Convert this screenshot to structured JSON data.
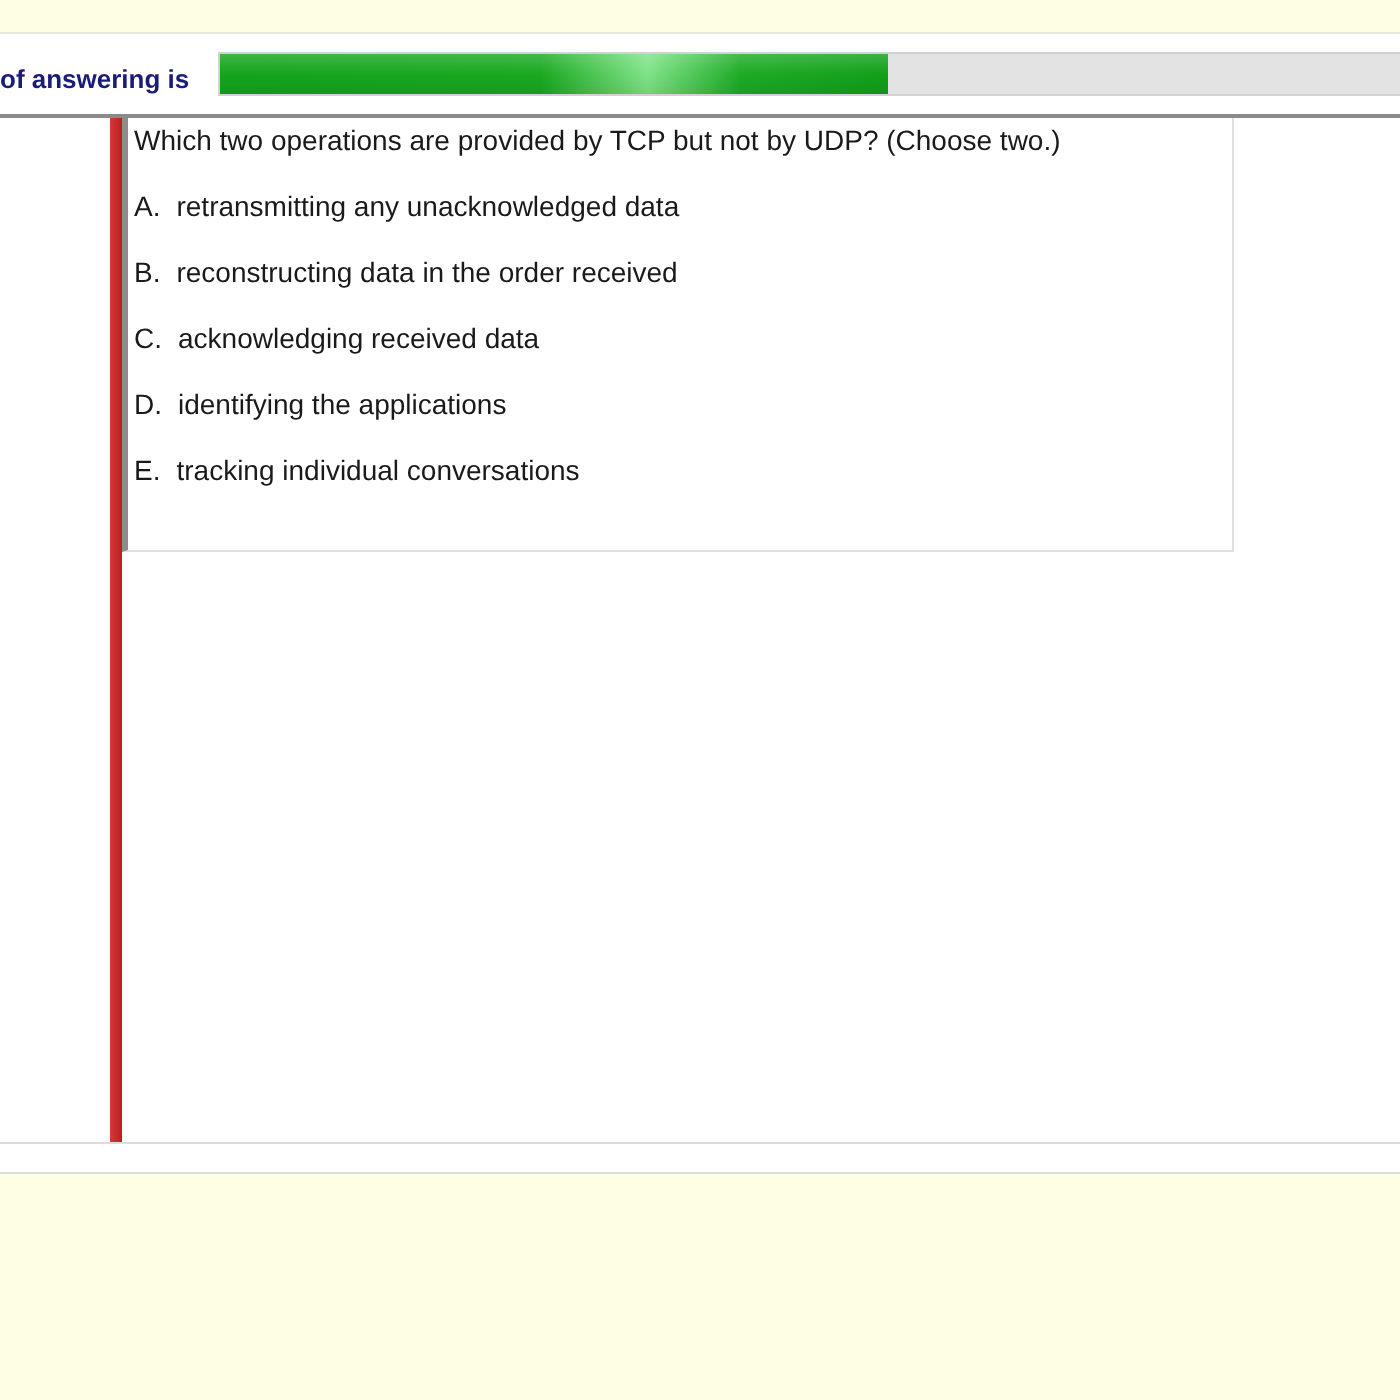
{
  "progress": {
    "label": "of answering is",
    "level": 0.566
  },
  "question": {
    "text": "Which two operations are provided by TCP but not by UDP? (Choose two.)",
    "options": [
      {
        "letter": "A.",
        "text": "retransmitting any unacknowledged data"
      },
      {
        "letter": "B.",
        "text": "reconstructing data in the order received"
      },
      {
        "letter": "C.",
        "text": "acknowledging received data"
      },
      {
        "letter": "D.",
        "text": "identifying the applications"
      },
      {
        "letter": "E.",
        "text": "tracking individual conversations"
      }
    ]
  }
}
